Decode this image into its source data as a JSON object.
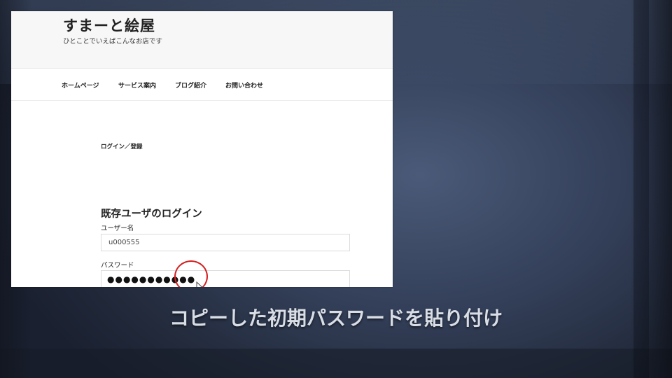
{
  "site": {
    "title": "すまーと絵屋",
    "tagline": "ひとことでいえばこんなお店です"
  },
  "nav": {
    "items": [
      {
        "label": "ホームページ"
      },
      {
        "label": "サービス案内"
      },
      {
        "label": "ブログ紹介"
      },
      {
        "label": "お問い合わせ"
      }
    ]
  },
  "page": {
    "breadcrumb": "ログイン／登録",
    "login_heading": "既存ユーザのログイン",
    "username_label": "ユーザー名",
    "username_value": "u000555",
    "password_label": "パスワード",
    "password_value": "●●●●●●●●●●●"
  },
  "caption": "コピーした初期パスワードを貼り付け",
  "colors": {
    "highlight_ring": "#d42020"
  },
  "icons": [
    "mouse-pointer-icon"
  ]
}
